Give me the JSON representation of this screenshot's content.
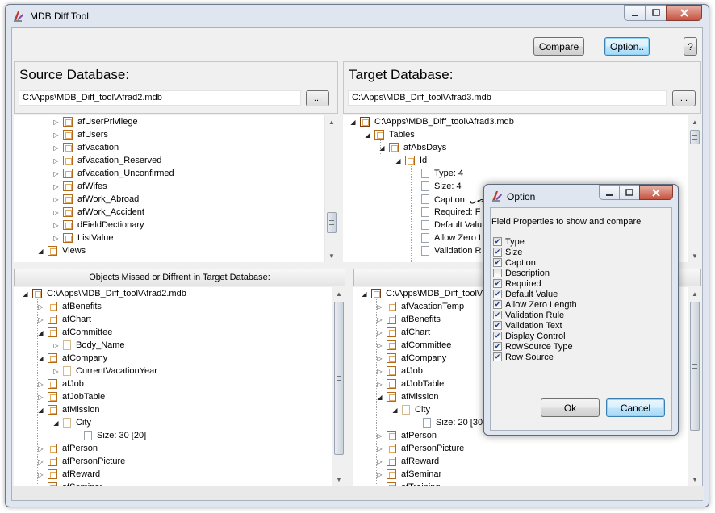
{
  "window": {
    "title": "MDB Diff Tool"
  },
  "toolbar": {
    "compare_label": "Compare",
    "option_label": "Option..",
    "help_label": "?"
  },
  "source": {
    "title": "Source Database:",
    "path": "C:\\Apps\\MDB_Diff_tool\\Afrad2.mdb",
    "browse_label": "...",
    "tree": [
      "afUserPrivilege",
      "afUsers",
      "afVacation",
      "afVacation_Reserved",
      "afVacation_Unconfirmed",
      "afWifes",
      "afWork_Abroad",
      "afWork_Accident",
      "dFieldDectionary",
      "ListValue",
      "Views"
    ]
  },
  "target": {
    "title": "Target Database:",
    "path": "C:\\Apps\\MDB_Diff_tool\\Afrad3.mdb",
    "browse_label": "...",
    "tree_root": "C:\\Apps\\MDB_Diff_tool\\Afrad3.mdb",
    "tree_tables": "Tables",
    "tree_table": "afAbsDays",
    "tree_field": "Id",
    "tree_props": [
      "Type: 4",
      "Size: 4",
      "Caption: فصل",
      "Required: F",
      "Default Valu",
      "Allow Zero L",
      "Validation R"
    ]
  },
  "missed_target": {
    "header": "Objects Missed or Diffrent in Target Database:",
    "root": "C:\\Apps\\MDB_Diff_tool\\Afrad2.mdb",
    "items": [
      "afBenefits",
      "afChart",
      "afCommittee",
      "Body_Name",
      "afCompany",
      "CurrentVacationYear",
      "afJob",
      "afJobTable",
      "afMission",
      "City",
      "Size: 30 [20]",
      "afPerson",
      "afPersonPicture",
      "afReward",
      "afSeminar"
    ]
  },
  "missed_source": {
    "header": "Objects Misse",
    "root": "C:\\Apps\\MDB_Diff_tool\\Af",
    "items": [
      "afVacationTemp",
      "afBenefits",
      "afChart",
      "afCommittee",
      "afCompany",
      "afJob",
      "afJobTable",
      "afMission",
      "City",
      "Size: 20 [30]",
      "afPerson",
      "afPersonPicture",
      "afReward",
      "afSeminar",
      "afTraining"
    ]
  },
  "dialog": {
    "title": "Option",
    "caption": "Field Properties to show and compare",
    "options": [
      {
        "label": "Type",
        "checked": true
      },
      {
        "label": "Size",
        "checked": true
      },
      {
        "label": "Caption",
        "checked": true
      },
      {
        "label": "Description",
        "checked": false
      },
      {
        "label": "Required",
        "checked": true
      },
      {
        "label": "Default Value",
        "checked": true
      },
      {
        "label": "Allow Zero Length",
        "checked": true
      },
      {
        "label": "Validation Rule",
        "checked": true
      },
      {
        "label": "Validation Text",
        "checked": true
      },
      {
        "label": "Display Control",
        "checked": true
      },
      {
        "label": "RowSource Type",
        "checked": true
      },
      {
        "label": "Row Source",
        "checked": true
      }
    ],
    "ok_label": "Ok",
    "cancel_label": "Cancel"
  },
  "colors": {
    "accent": "#3c7fb1",
    "close": "#c5523f",
    "folder": "#b46a1b"
  }
}
